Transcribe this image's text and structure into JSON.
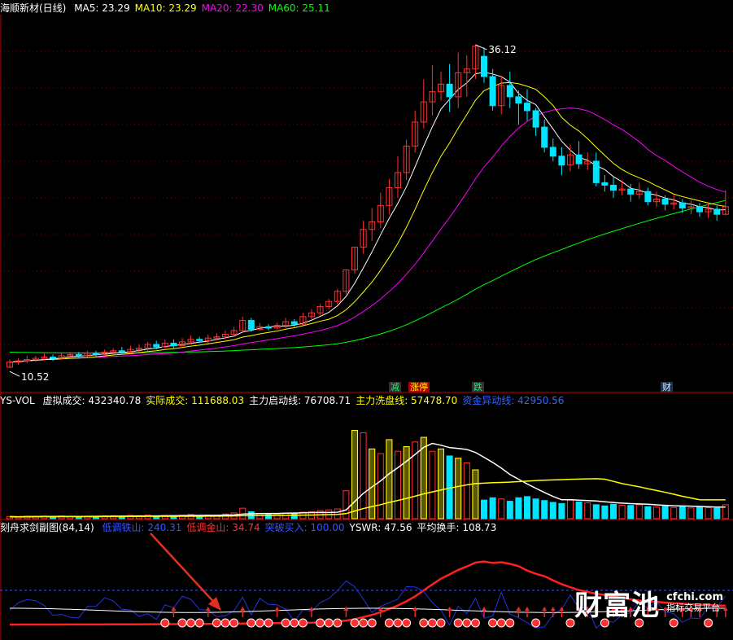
{
  "panel1": {
    "title": "海顺新材(日线)",
    "ma": [
      {
        "label": "MA5: 23.29",
        "color": "#ffffff"
      },
      {
        "label": "MA10: 23.29",
        "color": "#ffff00"
      },
      {
        "label": "MA20: 22.30",
        "color": "#ff00ff"
      },
      {
        "label": "MA60: 25.11",
        "color": "#00ff00"
      }
    ],
    "high_label": "36.12",
    "low_label": "10.52",
    "tags": [
      {
        "text": "减",
        "color": "#00ff66",
        "bg": "#303030"
      },
      {
        "text": "涨停",
        "color": "#ffff00",
        "bg": "#b00000"
      },
      {
        "text": "跌",
        "color": "#00ff66",
        "bg": "#303030"
      },
      {
        "text": "财",
        "color": "#cfe8ff",
        "bg": "#203050"
      }
    ]
  },
  "panel2": {
    "title": "YS-VOL",
    "items": [
      {
        "label": "虚拟成交: 432340.78",
        "color": "#ffffff"
      },
      {
        "label": "实际成交: 111688.03",
        "color": "#ffff00"
      },
      {
        "label": "主力启动线: 76708.71",
        "color": "#ffffff"
      },
      {
        "label": "主力洗盘线: 57478.70",
        "color": "#ffff00"
      },
      {
        "label": "资金异动线: 42950.56",
        "color": "#3366ff"
      }
    ]
  },
  "panel3": {
    "title": "刻舟求剑副图(84,14)",
    "items": [
      {
        "label": "低调铁山: 240.31",
        "color": "#3355ff"
      },
      {
        "label": "低调金山: 34.74",
        "color": "#ff3030"
      },
      {
        "label": "突破买入: 100.00",
        "color": "#3355ff"
      },
      {
        "label": "YSWR: 47.56",
        "color": "#ffffff"
      },
      {
        "label": "平均换手: 108.73",
        "color": "#ffffff"
      }
    ]
  },
  "watermark": {
    "main": "财富池",
    "site": "cfchi.com",
    "sub": "指标交易平台"
  },
  "colors": {
    "up": "#ff3030",
    "down": "#00e5ff",
    "ma5": "#ffffff",
    "ma10": "#ffff00",
    "ma20": "#ff00ff",
    "ma60": "#00ff00",
    "grid": "#8b0000"
  },
  "chart_data": {
    "type": "candlestick",
    "price": {
      "high": 36.12,
      "low": 10.52,
      "ylim": [
        9.5,
        38.5
      ],
      "candles": [
        [
          10.6,
          11.0,
          10.52,
          11.2
        ],
        [
          11.0,
          11.1,
          10.8,
          11.3
        ],
        [
          11.1,
          11.2,
          10.9,
          11.5
        ],
        [
          11.2,
          11.3,
          11.0,
          11.5
        ],
        [
          11.3,
          11.4,
          11.1,
          11.7
        ],
        [
          11.4,
          11.3,
          11.1,
          11.6
        ],
        [
          11.3,
          11.5,
          11.2,
          11.7
        ],
        [
          11.5,
          11.6,
          11.3,
          11.8
        ],
        [
          11.6,
          11.5,
          11.3,
          11.8
        ],
        [
          11.5,
          11.7,
          11.4,
          11.9
        ],
        [
          11.7,
          11.6,
          11.4,
          11.9
        ],
        [
          11.6,
          11.8,
          11.5,
          12.0
        ],
        [
          11.8,
          11.9,
          11.6,
          12.1
        ],
        [
          11.9,
          11.8,
          11.6,
          12.2
        ],
        [
          11.8,
          12.0,
          11.7,
          12.3
        ],
        [
          12.0,
          12.1,
          11.8,
          12.4
        ],
        [
          12.1,
          12.4,
          11.9,
          12.6
        ],
        [
          12.4,
          12.2,
          12.0,
          12.7
        ],
        [
          12.2,
          12.5,
          12.1,
          12.8
        ],
        [
          12.5,
          12.3,
          12.1,
          12.8
        ],
        [
          12.3,
          12.6,
          12.2,
          12.9
        ],
        [
          12.6,
          12.8,
          12.4,
          13.1
        ],
        [
          12.8,
          12.7,
          12.5,
          13.0
        ],
        [
          12.7,
          12.9,
          12.5,
          13.2
        ],
        [
          12.9,
          13.0,
          12.7,
          13.3
        ],
        [
          13.0,
          13.2,
          12.8,
          13.5
        ],
        [
          13.2,
          13.5,
          13.0,
          13.8
        ],
        [
          13.5,
          14.3,
          13.3,
          14.6
        ],
        [
          14.3,
          13.6,
          13.4,
          14.5
        ],
        [
          13.6,
          13.8,
          13.5,
          14.1
        ],
        [
          13.8,
          13.7,
          13.5,
          14.0
        ],
        [
          13.7,
          13.9,
          13.6,
          14.1
        ],
        [
          13.9,
          14.2,
          13.7,
          14.5
        ],
        [
          14.2,
          14.0,
          13.8,
          14.4
        ],
        [
          14.0,
          14.6,
          13.9,
          14.9
        ],
        [
          14.6,
          14.9,
          14.4,
          15.2
        ],
        [
          14.9,
          15.4,
          14.7,
          15.6
        ],
        [
          15.4,
          15.8,
          15.2,
          16.0
        ],
        [
          15.8,
          16.6,
          15.6,
          16.8
        ],
        [
          16.6,
          18.3,
          16.4,
          18.3
        ],
        [
          18.3,
          20.1,
          18.0,
          20.1
        ],
        [
          20.1,
          21.5,
          19.6,
          22.2
        ],
        [
          21.5,
          22.1,
          20.6,
          23.2
        ],
        [
          22.1,
          23.4,
          21.6,
          24.4
        ],
        [
          23.4,
          24.8,
          22.7,
          25.5
        ],
        [
          24.8,
          26.0,
          24.0,
          27.3
        ],
        [
          26.0,
          28.1,
          25.4,
          28.6
        ],
        [
          28.1,
          30.0,
          27.6,
          30.9
        ],
        [
          30.0,
          31.6,
          29.5,
          33.4
        ],
        [
          31.6,
          32.4,
          30.5,
          34.5
        ],
        [
          32.4,
          33.0,
          31.7,
          34.0
        ],
        [
          33.0,
          32.0,
          30.8,
          34.6
        ],
        [
          32.0,
          33.9,
          31.1,
          35.5
        ],
        [
          33.9,
          34.2,
          32.0,
          35.3
        ],
        [
          34.2,
          36.0,
          33.4,
          36.12
        ],
        [
          35.2,
          33.6,
          33.1,
          35.9
        ],
        [
          33.6,
          31.3,
          30.9,
          34.2
        ],
        [
          31.3,
          32.9,
          30.6,
          33.6
        ],
        [
          32.9,
          32.0,
          31.1,
          34.0
        ],
        [
          32.0,
          31.5,
          29.8,
          32.5
        ],
        [
          31.5,
          30.9,
          30.1,
          32.6
        ],
        [
          30.9,
          29.6,
          28.9,
          31.1
        ],
        [
          29.6,
          28.0,
          27.6,
          30.2
        ],
        [
          28.0,
          27.3,
          26.9,
          28.7
        ],
        [
          27.3,
          26.6,
          25.8,
          28.0
        ],
        [
          26.6,
          27.4,
          26.1,
          28.2
        ],
        [
          27.4,
          26.7,
          26.3,
          28.5
        ],
        [
          26.7,
          26.9,
          26.2,
          27.6
        ],
        [
          26.9,
          25.2,
          24.9,
          27.6
        ],
        [
          25.2,
          25.0,
          24.5,
          25.8
        ],
        [
          25.0,
          24.6,
          24.0,
          25.6
        ],
        [
          24.6,
          24.7,
          24.2,
          25.4
        ],
        [
          24.7,
          24.3,
          23.7,
          25.1
        ],
        [
          24.3,
          24.5,
          23.9,
          25.2
        ],
        [
          24.5,
          23.7,
          23.4,
          24.8
        ],
        [
          23.7,
          23.9,
          23.3,
          24.5
        ],
        [
          23.9,
          23.5,
          23.0,
          24.2
        ],
        [
          23.5,
          23.6,
          23.1,
          24.2
        ],
        [
          23.6,
          23.2,
          22.8,
          23.9
        ],
        [
          23.2,
          23.3,
          22.7,
          23.8
        ],
        [
          23.3,
          22.9,
          22.5,
          23.6
        ],
        [
          22.9,
          23.1,
          22.4,
          23.6
        ],
        [
          23.1,
          22.7,
          22.2,
          23.4
        ],
        [
          22.7,
          23.3,
          22.6,
          24.6
        ]
      ]
    },
    "volume": {
      "ylim": [
        0,
        480000
      ],
      "values": [
        9000,
        8000,
        10000,
        9500,
        11000,
        9000,
        12000,
        10000,
        9000,
        11000,
        10000,
        12000,
        13000,
        11000,
        14000,
        13000,
        15000,
        12000,
        14000,
        13000,
        15000,
        18000,
        14000,
        16000,
        15000,
        20000,
        25000,
        45000,
        30000,
        22000,
        18000,
        20000,
        24000,
        21000,
        28000,
        30000,
        35000,
        38000,
        42000,
        120000,
        380000,
        370000,
        300000,
        280000,
        340000,
        290000,
        310000,
        330000,
        350000,
        290000,
        300000,
        270000,
        260000,
        240000,
        210000,
        80000,
        90000,
        85000,
        75000,
        90000,
        95000,
        85000,
        78000,
        70000,
        65000,
        80000,
        72000,
        68000,
        60000,
        55000,
        62000,
        58000,
        57000,
        60000,
        52000,
        50000,
        53000,
        48000,
        51000,
        46000,
        49000,
        47000,
        45000,
        60000
      ]
    },
    "indicator": {
      "ylim": [
        0,
        250
      ],
      "signal_day_start": 18,
      "signal_day_end": 83
    }
  }
}
